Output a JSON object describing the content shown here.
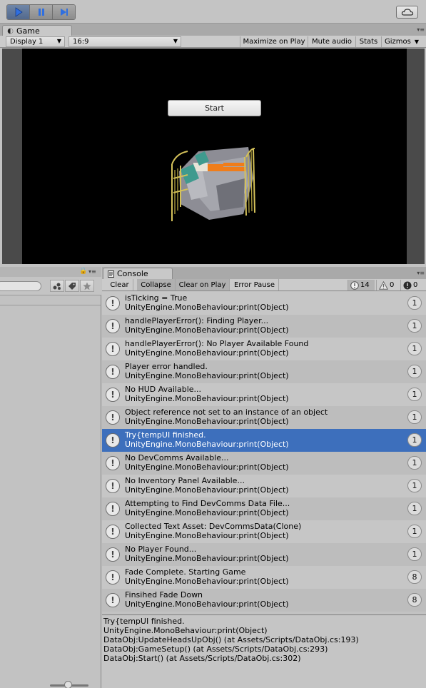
{
  "toolbar": {
    "play_icon": "play-icon",
    "pause_icon": "pause-icon",
    "step_icon": "step-icon",
    "cloud_icon": "cloud-icon"
  },
  "game": {
    "tab_label": "Game",
    "display": "Display 1",
    "aspect": "16:9",
    "toggles": [
      "Maximize on Play",
      "Mute audio",
      "Stats",
      "Gizmos"
    ],
    "start_button": "Start"
  },
  "console": {
    "tab_label": "Console",
    "buttons": [
      "Clear",
      "Collapse",
      "Clear on Play",
      "Error Pause"
    ],
    "counts": {
      "info": "14",
      "warnings": "0",
      "errors": "0"
    },
    "entries": [
      {
        "line1": "isTicking = True",
        "line2": "UnityEngine.MonoBehaviour:print(Object)",
        "count": "1"
      },
      {
        "line1": "handlePlayerError(): Finding Player...",
        "line2": "UnityEngine.MonoBehaviour:print(Object)",
        "count": "1"
      },
      {
        "line1": "handlePlayerError(): No Player Available Found",
        "line2": "UnityEngine.MonoBehaviour:print(Object)",
        "count": "1"
      },
      {
        "line1": "Player error handled.",
        "line2": "UnityEngine.MonoBehaviour:print(Object)",
        "count": "1"
      },
      {
        "line1": "No HUD Available...",
        "line2": "UnityEngine.MonoBehaviour:print(Object)",
        "count": "1"
      },
      {
        "line1": "Object reference not set to an instance of an object",
        "line2": "UnityEngine.MonoBehaviour:print(Object)",
        "count": "1"
      },
      {
        "line1": "Try{tempUI finished.",
        "line2": "UnityEngine.MonoBehaviour:print(Object)",
        "count": "1"
      },
      {
        "line1": "No DevComms Available...",
        "line2": "UnityEngine.MonoBehaviour:print(Object)",
        "count": "1"
      },
      {
        "line1": "No Inventory Panel Available...",
        "line2": "UnityEngine.MonoBehaviour:print(Object)",
        "count": "1"
      },
      {
        "line1": "Attempting to Find DevComms Data File...",
        "line2": "UnityEngine.MonoBehaviour:print(Object)",
        "count": "1"
      },
      {
        "line1": "Collected Text Asset: DevCommsData(Clone)",
        "line2": "UnityEngine.MonoBehaviour:print(Object)",
        "count": "1"
      },
      {
        "line1": "No Player Found...",
        "line2": "UnityEngine.MonoBehaviour:print(Object)",
        "count": "1"
      },
      {
        "line1": "Fade Complete. Starting Game",
        "line2": "UnityEngine.MonoBehaviour:print(Object)",
        "count": "8"
      },
      {
        "line1": "Finsihed Fade Down",
        "line2": "UnityEngine.MonoBehaviour:print(Object)",
        "count": "8"
      }
    ],
    "selected_index": 6,
    "detail_lines": [
      "Try{tempUI finished.",
      "UnityEngine.MonoBehaviour:print(Object)",
      "DataObj:UpdateHeadsUpObj() (at Assets/Scripts/DataObj.cs:193)",
      "DataObj:GameSetup() (at Assets/Scripts/DataObj.cs:293)",
      "DataObj:Start() (at Assets/Scripts/DataObj.cs:302)"
    ]
  },
  "colors": {
    "selected_row": "#3d6fbc",
    "play_active": "#5f789c"
  }
}
